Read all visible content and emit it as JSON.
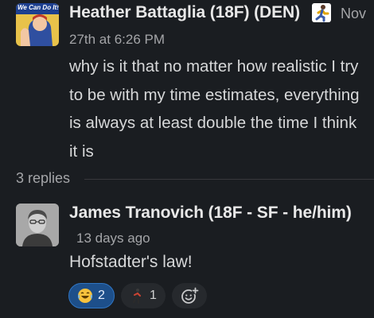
{
  "parent": {
    "author": "Heather Battaglia (18F) (DEN)",
    "avatar_text": "We Can Do It!",
    "status_emoji": "person-running-emoji",
    "truncated_time": "Nov",
    "timestamp": "27th at 6:26 PM",
    "message": "why is it that no matter how realistic I try to be with my time estimates, everything is always at least double the time I think it is"
  },
  "thread": {
    "replies_label": "3 replies"
  },
  "reply": {
    "author": "James Tranovich (18F - SF - he/him)",
    "timestamp": "13 days ago",
    "message": "Hofstadter's law!",
    "reactions": [
      {
        "icon": "laughing-emoji",
        "count": "2",
        "selected": true
      },
      {
        "icon": "person-walking-emoji",
        "count": "1",
        "selected": false
      }
    ],
    "add_reaction_icon": "add-reaction-icon"
  },
  "colors": {
    "background": "#1a1d21",
    "selected_reaction_bg": "#1d4f8a",
    "selected_reaction_border": "#2f75c3",
    "muted_text": "#a4a5a8"
  }
}
